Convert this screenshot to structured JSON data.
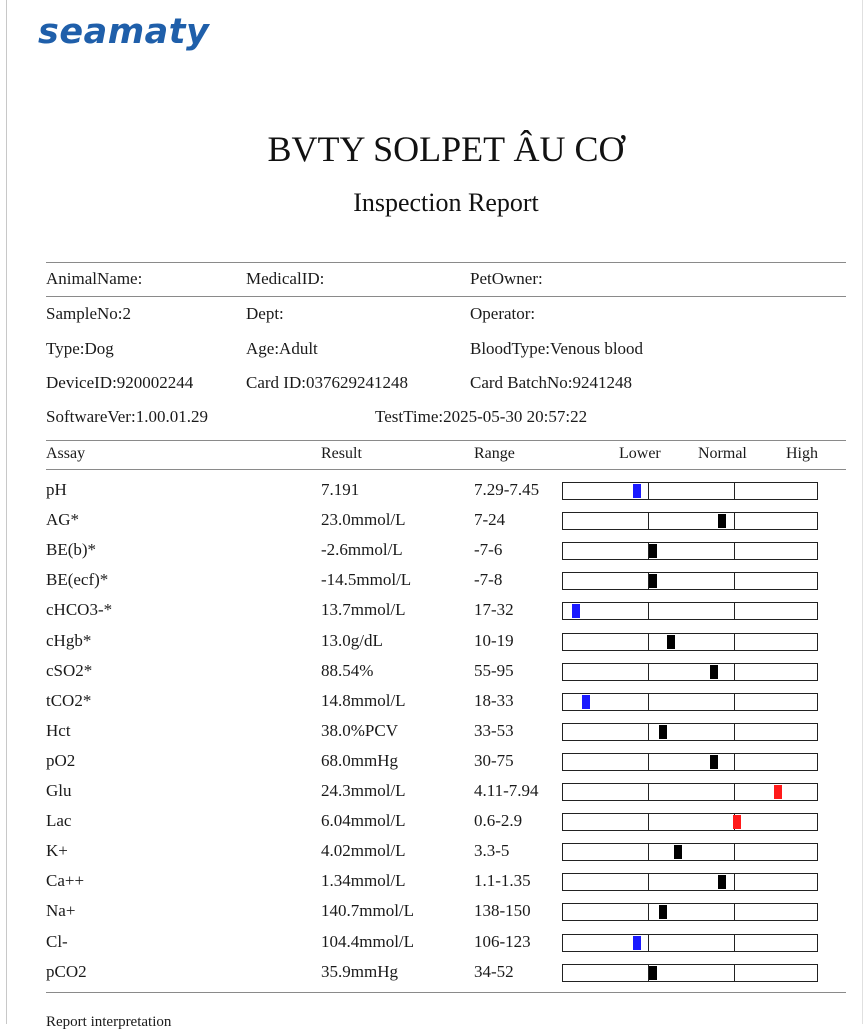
{
  "logo": "seamaty",
  "title": "BVTY SOLPET ÂU CƠ",
  "subtitle": "Inspection Report",
  "info": {
    "animal_name": "AnimalName:",
    "medical_id": "MedicalID:",
    "pet_owner": "PetOwner:",
    "sample_no": "SampleNo:2",
    "dept": "Dept:",
    "operator": "Operator:",
    "type": "Type:Dog",
    "age": "Age:Adult",
    "blood_type": "BloodType:Venous blood",
    "device_id": "DeviceID:920002244",
    "card_id": "Card ID:037629241248",
    "card_batch": "Card BatchNo:9241248",
    "software_ver": "SoftwareVer:1.00.01.29",
    "test_time": "TestTime:2025-05-30 20:57:22"
  },
  "table": {
    "headers": {
      "assay": "Assay",
      "result": "Result",
      "range": "Range",
      "lower": "Lower",
      "normal": "Normal",
      "high": "High"
    },
    "rows": [
      {
        "assay": "pH",
        "result": "7.191",
        "range": "7.29-7.45",
        "status": "low",
        "level": 0.29
      },
      {
        "assay": "AG*",
        "result": "23.0mmol/L",
        "range": "7-24",
        "status": "normal",
        "level": 0.62
      },
      {
        "assay": "BE(b)*",
        "result": "-2.6mmol/L",
        "range": "-7-6",
        "status": "normal",
        "level": 0.35
      },
      {
        "assay": "BE(ecf)*",
        "result": "-14.5mmol/L",
        "range": "-7-8",
        "status": "normal",
        "level": 0.35
      },
      {
        "assay": "cHCO3-*",
        "result": "13.7mmol/L",
        "range": "17-32",
        "status": "low",
        "level": 0.05
      },
      {
        "assay": "cHgb*",
        "result": "13.0g/dL",
        "range": "10-19",
        "status": "normal",
        "level": 0.42
      },
      {
        "assay": "cSO2*",
        "result": "88.54%",
        "range": "55-95",
        "status": "normal",
        "level": 0.59
      },
      {
        "assay": "tCO2*",
        "result": "14.8mmol/L",
        "range": "18-33",
        "status": "low",
        "level": 0.09
      },
      {
        "assay": "Hct",
        "result": "38.0%PCV",
        "range": "33-53",
        "status": "normal",
        "level": 0.39
      },
      {
        "assay": "pO2",
        "result": "68.0mmHg",
        "range": "30-75",
        "status": "normal",
        "level": 0.59
      },
      {
        "assay": "Glu",
        "result": "24.3mmol/L",
        "range": "4.11-7.94",
        "status": "high",
        "level": 0.84
      },
      {
        "assay": "Lac",
        "result": "6.04mmol/L",
        "range": "0.6-2.9",
        "status": "high",
        "level": 0.68
      },
      {
        "assay": "K+",
        "result": "4.02mmol/L",
        "range": "3.3-5",
        "status": "normal",
        "level": 0.45
      },
      {
        "assay": "Ca++",
        "result": "1.34mmol/L",
        "range": "1.1-1.35",
        "status": "normal",
        "level": 0.62
      },
      {
        "assay": "Na+",
        "result": "140.7mmol/L",
        "range": "138-150",
        "status": "normal",
        "level": 0.39
      },
      {
        "assay": "Cl-",
        "result": "104.4mmol/L",
        "range": "106-123",
        "status": "low",
        "level": 0.29
      },
      {
        "assay": "pCO2",
        "result": "35.9mmHg",
        "range": "34-52",
        "status": "normal",
        "level": 0.35
      }
    ]
  },
  "colors": {
    "low": "#1a1aff",
    "normal": "#000000",
    "high": "#ff1a1a",
    "logo": "#1f5faa"
  },
  "footer": "Report interpretation"
}
